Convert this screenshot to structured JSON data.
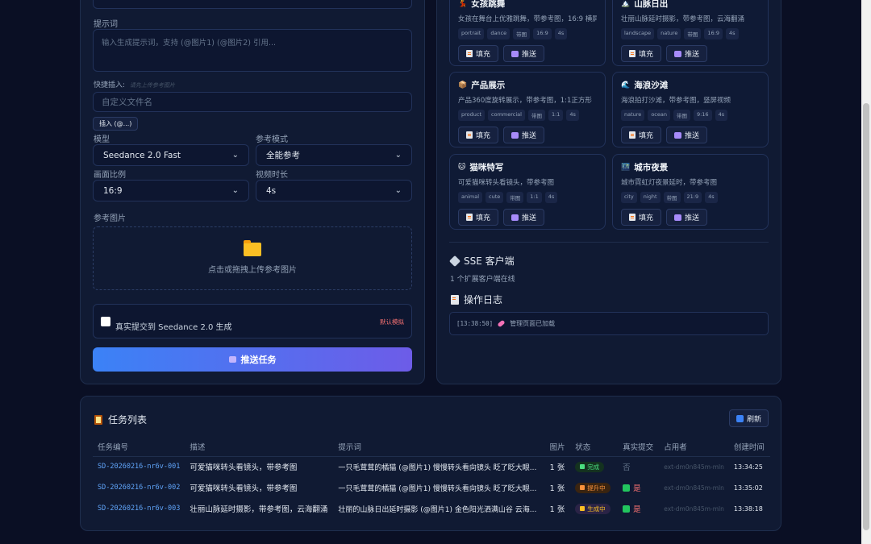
{
  "form": {
    "prompt_label": "提示词",
    "prompt_placeholder": "输入生成提示词，支持 (@图片1) (@图片2) 引用...",
    "quick_insert_label": "快捷插入:",
    "quick_insert_hint": "请先上传参考图片",
    "filename_placeholder": "自定义文件名",
    "insert_button": "插入 (@...)",
    "model_label": "模型",
    "model_value": "Seedance 2.0 Fast",
    "ref_mode_label": "参考模式",
    "ref_mode_value": "全能参考",
    "ratio_label": "画面比例",
    "ratio_value": "16:9",
    "duration_label": "视频时长",
    "duration_value": "4s",
    "ref_images_label": "参考图片",
    "upload_text": "点击或拖拽上传参考图片",
    "real_submit_label": "真实提交到 Seedance 2.0 生成",
    "default_mock": "默认模拟",
    "push_button": "推送任务"
  },
  "templates": [
    {
      "emoji": "💃",
      "title": "女孩跳舞",
      "desc": "女孩在舞台上优雅跳舞，带参考图，16:9 横屏",
      "tags": [
        "portrait",
        "dance",
        "带图",
        "16:9",
        "4s"
      ]
    },
    {
      "emoji": "🏔️",
      "title": "山脉日出",
      "desc": "壮丽山脉延时摄影，带参考图，云海翻涌",
      "tags": [
        "landscape",
        "nature",
        "带图",
        "16:9",
        "4s"
      ]
    },
    {
      "emoji": "📦",
      "title": "产品展示",
      "desc": "产品360度旋转展示，带参考图，1:1正方形",
      "tags": [
        "product",
        "commercial",
        "带图",
        "1:1",
        "4s"
      ]
    },
    {
      "emoji": "🌊",
      "title": "海浪沙滩",
      "desc": "海浪拍打沙滩，带参考图，竖屏视频",
      "tags": [
        "nature",
        "ocean",
        "带图",
        "9:16",
        "4s"
      ]
    },
    {
      "emoji": "🐱",
      "title": "猫咪特写",
      "desc": "可爱猫咪转头看镜头，带参考图",
      "tags": [
        "animal",
        "cute",
        "带图",
        "1:1",
        "4s"
      ]
    },
    {
      "emoji": "🌃",
      "title": "城市夜景",
      "desc": "城市霓虹灯夜景延时，带参考图",
      "tags": [
        "city",
        "night",
        "带图",
        "21:9",
        "4s"
      ]
    }
  ],
  "card_buttons": {
    "fill": "填充",
    "push": "推送"
  },
  "sse": {
    "title": "SSE 客户端",
    "status": "1 个扩展客户端在线"
  },
  "log": {
    "title": "操作日志",
    "time": "[13:38:50]",
    "message": "管理页面已加载"
  },
  "tasks": {
    "title": "任务列表",
    "refresh": "刷新",
    "columns": [
      "任务编号",
      "描述",
      "提示词",
      "图片",
      "状态",
      "真实提交",
      "占用者",
      "创建时间"
    ],
    "rows": [
      {
        "id": "SD-20260216-nr6v-001",
        "desc": "可爱猫咪转头看镜头，带参考图",
        "prompt": "一只毛茸茸的橘猫 (@图片1) 慢慢转头看向镜头 眨了眨大眼...",
        "images": "1 张",
        "status": "完成",
        "real": "否",
        "owner": "ext-dm0n845m-mln",
        "time": "13:34:25"
      },
      {
        "id": "SD-20260216-nr6v-002",
        "desc": "可爱猫咪转头看镜头，带参考图",
        "prompt": "一只毛茸茸的橘猫 (@图片1) 慢慢转头看向镜头 眨了眨大眼...",
        "images": "1 张",
        "status": "提升中",
        "real": "是",
        "owner": "ext-dm0n845m-mln",
        "time": "13:35:02"
      },
      {
        "id": "SD-20260216-nr6v-003",
        "desc": "壮丽山脉延时摄影，带参考图，云海翻涌",
        "prompt": "壮丽的山脉日出延时摄影 (@图片1) 金色阳光洒满山谷 云海...",
        "images": "1 张",
        "status": "生成中",
        "real": "是",
        "owner": "ext-dm0n845m-mln",
        "time": "13:38:18"
      }
    ]
  },
  "colors": {
    "accent_from": "#3b82f6",
    "accent_to": "#6d5ce8",
    "done": "#22c55e",
    "warn": "#f59e0b",
    "danger": "#ef4444"
  }
}
